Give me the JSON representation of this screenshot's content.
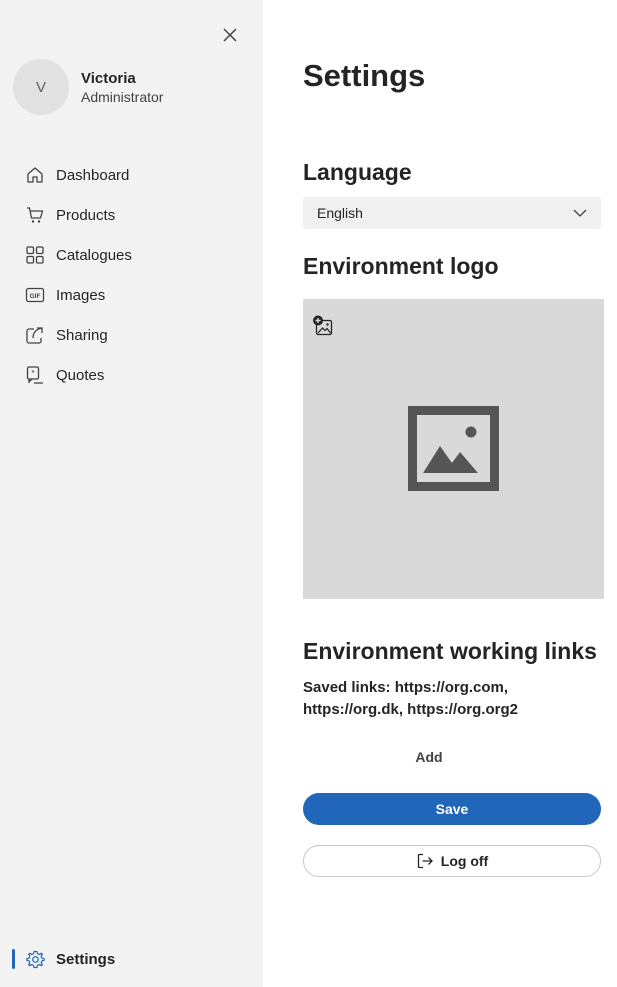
{
  "sidebar": {
    "user": {
      "initial": "V",
      "name": "Victoria",
      "role": "Administrator"
    },
    "items": [
      {
        "label": "Dashboard",
        "icon": "home-icon"
      },
      {
        "label": "Products",
        "icon": "cart-icon"
      },
      {
        "label": "Catalogues",
        "icon": "grid-icon"
      },
      {
        "label": "Images",
        "icon": "gif-icon"
      },
      {
        "label": "Sharing",
        "icon": "share-icon"
      },
      {
        "label": "Quotes",
        "icon": "quote-icon"
      }
    ],
    "settings": {
      "label": "Settings",
      "icon": "gear-icon",
      "active": true
    }
  },
  "main": {
    "title": "Settings",
    "language": {
      "heading": "Language",
      "selected": "English"
    },
    "logo": {
      "heading": "Environment logo"
    },
    "links": {
      "heading": "Environment working links",
      "saved_text": "Saved links: https://org.com, https://org.dk, https://org.org2",
      "add_label": "Add"
    },
    "save_label": "Save",
    "logoff_label": "Log off"
  },
  "colors": {
    "accent": "#2166b8",
    "sidebar_bg": "#f3f3f3",
    "logo_bg": "#d9d9d9"
  }
}
